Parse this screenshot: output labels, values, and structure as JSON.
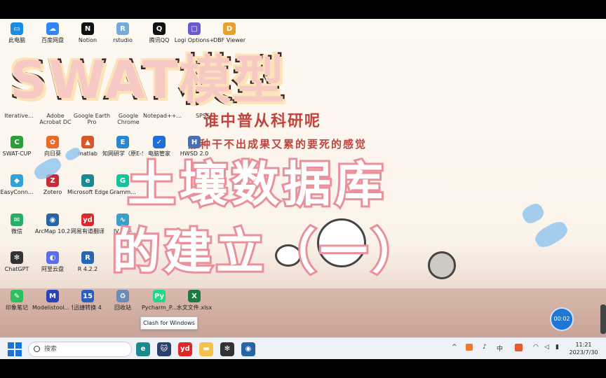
{
  "desktop_icons": [
    {
      "label": "此电脑",
      "icon": "computer-icon",
      "color": "#1b8de0",
      "glyph": "▭"
    },
    {
      "label": "百度网盘",
      "icon": "cloud-icon",
      "color": "#2f86f6",
      "glyph": "☁"
    },
    {
      "label": "Notion",
      "icon": "notion-icon",
      "color": "#111111",
      "glyph": "N"
    },
    {
      "label": "rstudio",
      "icon": "rstudio-icon",
      "color": "#75aadb",
      "glyph": "R"
    },
    {
      "label": "腾讯QQ",
      "icon": "qq-icon",
      "color": "#111111",
      "glyph": "Q"
    },
    {
      "label": "Logi Options+",
      "icon": "logi-icon",
      "color": "#6a5acd",
      "glyph": "□"
    },
    {
      "label": "DBF Viewer",
      "icon": "dbf-icon",
      "color": "#e7a12f",
      "glyph": "D"
    },
    {
      "label": "SWAT-CUP",
      "icon": "swatcup-icon",
      "color": "#2c9f3a",
      "glyph": "C"
    },
    {
      "label": "向日葵",
      "icon": "sunflower-icon",
      "color": "#f0672a",
      "glyph": "✿"
    },
    {
      "label": "matlab",
      "icon": "matlab-icon",
      "color": "#d9562b",
      "glyph": "▲"
    },
    {
      "label": "知网研学（原E-Study）",
      "icon": "estudy-icon",
      "color": "#2a86d1",
      "glyph": "E"
    },
    {
      "label": "电脑管家",
      "icon": "shield-icon",
      "color": "#1e6fd9",
      "glyph": "✓"
    },
    {
      "label": "HWSD 2.0",
      "icon": "hwsd-icon",
      "color": "#4b6fb3",
      "glyph": "H"
    },
    {
      "label": "EasyConn...",
      "icon": "easyconnect-icon",
      "color": "#2fa4d8",
      "glyph": "◆"
    },
    {
      "label": "Zotero",
      "icon": "zotero-icon",
      "color": "#cc2936",
      "glyph": "Z"
    },
    {
      "label": "Microsoft Edge",
      "icon": "edge-icon",
      "color": "#1b8a8f",
      "glyph": "e"
    },
    {
      "label": "Gramm...",
      "icon": "grammarly-icon",
      "color": "#15c39a",
      "glyph": "G"
    },
    {
      "label": "微信",
      "icon": "wechat-icon",
      "color": "#2aae67",
      "glyph": "✉"
    },
    {
      "label": "ArcMap 10.2",
      "icon": "arcmap-icon",
      "color": "#2664a6",
      "glyph": "◉"
    },
    {
      "label": "网易有道翻译",
      "icon": "youdao-icon",
      "color": "#e02727",
      "glyph": "yd"
    },
    {
      "label": "IV 助手",
      "icon": "iv-icon",
      "color": "#3aa0c9",
      "glyph": "∿"
    },
    {
      "label": "ChatGPT",
      "icon": "chatgpt-icon",
      "color": "#333333",
      "glyph": "✻"
    },
    {
      "label": "阿里云盘",
      "icon": "aliyun-icon",
      "color": "#5b6cf0",
      "glyph": "◐"
    },
    {
      "label": "R 4.2.2",
      "icon": "r-icon",
      "color": "#2367b9",
      "glyph": "R"
    },
    {
      "label": "印象笔记",
      "icon": "evernote-icon",
      "color": "#2dbe60",
      "glyph": "✎"
    },
    {
      "label": "Modelistool... 快捷方式",
      "icon": "modelis-icon",
      "color": "#2a44b5",
      "glyph": "M"
    },
    {
      "label": "迅捷转换 4",
      "icon": "converter-icon",
      "color": "#2a5fbf",
      "glyph": "15"
    },
    {
      "label": "回收站",
      "icon": "recycle-bin-icon",
      "color": "#6a8db8",
      "glyph": "♻"
    },
    {
      "label": "Pycharm_P...",
      "icon": "pycharm-icon",
      "color": "#21d789",
      "glyph": "Py"
    },
    {
      "label": "水文文件.xlsx",
      "icon": "excel-icon",
      "color": "#1e7a44",
      "glyph": "X"
    }
  ],
  "bg_partial_labels": [
    {
      "text": "Iterative..."
    },
    {
      "text": "Adobe Acrobat DC"
    },
    {
      "text": "Google Earth Pro"
    },
    {
      "text": "Google Chrome"
    },
    {
      "text": "Notepad++..."
    },
    {
      "text": "SPSS"
    }
  ],
  "overlay": {
    "title": "SWAT模型",
    "subtitle_line1": "土壤数据库",
    "subtitle_line2": "的建立（一）",
    "bg_slogan_1": "谁中普从科研呢",
    "bg_slogan_2": "那种干不出成果又累的要死的感觉"
  },
  "tooltip": {
    "text": "Clash for Windows"
  },
  "recording_timer": {
    "text": "00:02"
  },
  "taskbar": {
    "search_placeholder": "搜索",
    "apps": [
      {
        "icon": "edge-icon",
        "color": "#1b8a8f",
        "glyph": "e"
      },
      {
        "icon": "clash-icon",
        "color": "#2b3f6b",
        "glyph": "🐱"
      },
      {
        "icon": "youdao-icon",
        "color": "#e02727",
        "glyph": "yd"
      },
      {
        "icon": "folder-icon",
        "color": "#f2c14e",
        "glyph": "▬"
      },
      {
        "icon": "chatgpt-icon",
        "color": "#333333",
        "glyph": "✻"
      },
      {
        "icon": "arcmap-icon",
        "color": "#2664a6",
        "glyph": "◉"
      }
    ],
    "tray_ime": "中",
    "time": "11:21",
    "date": "2023/7/30"
  }
}
